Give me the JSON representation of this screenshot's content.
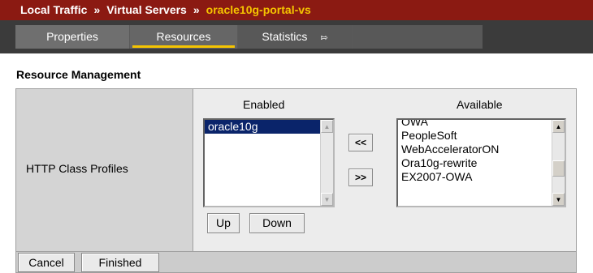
{
  "breadcrumb": {
    "items": [
      "Local Traffic",
      "Virtual Servers",
      "oracle10g-portal-vs"
    ],
    "separator": "»"
  },
  "tabs": {
    "properties": "Properties",
    "resources": "Resources",
    "statistics": "Statistics",
    "statistics_icon": "external-arrow-icon",
    "active": "Resources"
  },
  "section": {
    "title": "Resource Management"
  },
  "row": {
    "label": "HTTP Class Profiles",
    "enabled_header": "Enabled",
    "available_header": "Available",
    "enabled_items": [
      "oracle10g"
    ],
    "enabled_selected": "oracle10g",
    "available_items": [
      "OWA",
      "PeopleSoft",
      "WebAcceleratorON",
      "Ora10g-rewrite",
      "EX2007-OWA"
    ],
    "move_left_label": "<<",
    "move_right_label": ">>",
    "up_label": "Up",
    "down_label": "Down"
  },
  "footer": {
    "cancel_label": "Cancel",
    "finished_label": "Finished"
  },
  "colors": {
    "breadcrumb_bg": "#8b1a12",
    "breadcrumb_current": "#f5c400",
    "tab_bar_bg": "#3b3b3b",
    "active_tab_underline": "#f5c400",
    "selection_bg": "#0a246a"
  }
}
